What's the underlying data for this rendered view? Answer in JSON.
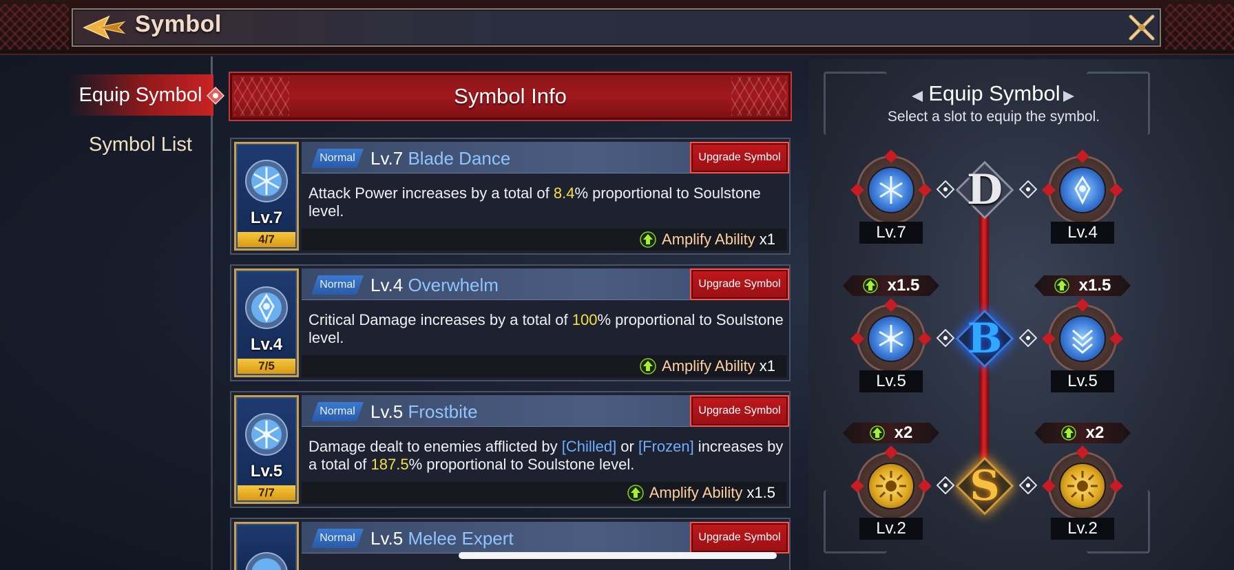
{
  "header": {
    "title": "Symbol",
    "back_icon": "back-arrow-icon",
    "close_icon": "crossed-swords-close-icon"
  },
  "nav": {
    "items": [
      {
        "label": "Equip Symbol",
        "active": true
      },
      {
        "label": "Symbol List",
        "active": false
      }
    ]
  },
  "symbol_info": {
    "title": "Symbol Info",
    "cards": [
      {
        "grade": "Normal",
        "level": "Lv.7",
        "name": "Blade Dance",
        "thumb_level": "Lv.7",
        "count": "4/7",
        "upgrade_label": "Upgrade Symbol",
        "desc_pre": "Attack Power increases by a total of ",
        "desc_value": "8.4",
        "desc_post": "% proportional to Soulstone level.",
        "amplify_label": "Amplify Ability",
        "amplify_mult": "x1",
        "icon": "blade-dance-icon"
      },
      {
        "grade": "Normal",
        "level": "Lv.4",
        "name": "Overwhelm",
        "thumb_level": "Lv.4",
        "count": "7/5",
        "upgrade_label": "Upgrade Symbol",
        "desc_pre": "Critical Damage increases by a total of ",
        "desc_value": "100",
        "desc_post": "% proportional to Soulstone level.",
        "amplify_label": "Amplify Ability",
        "amplify_mult": "x1",
        "icon": "overwhelm-icon"
      },
      {
        "grade": "Normal",
        "level": "Lv.5",
        "name": "Frostbite",
        "thumb_level": "Lv.5",
        "count": "7/7",
        "upgrade_label": "Upgrade Symbol",
        "desc_pre": "Damage dealt to enemies afflicted by ",
        "desc_kw1": "[Chilled]",
        "desc_mid": " or ",
        "desc_kw2": "[Frozen]",
        "desc_mid2": " increases by a total of ",
        "desc_value": "187.5",
        "desc_post": "% proportional to Soulstone level.",
        "amplify_label": "Amplify Ability",
        "amplify_mult": "x1.5",
        "icon": "snowflake-icon"
      },
      {
        "grade": "Normal",
        "level": "Lv.5",
        "name": "Melee Expert",
        "upgrade_label": "Upgrade Symbol",
        "icon": "melee-expert-icon"
      }
    ]
  },
  "equip_panel": {
    "title": "Equip Symbol",
    "subtitle": "Select a slot to equip the symbol.",
    "grades": [
      "D",
      "B",
      "S"
    ],
    "slots": [
      {
        "pos": "d-left",
        "level": "Lv.7",
        "icon": "blade-dance-icon",
        "color": "blue"
      },
      {
        "pos": "d-right",
        "level": "Lv.4",
        "icon": "overwhelm-icon",
        "color": "blue"
      },
      {
        "pos": "b-left",
        "level": "Lv.5",
        "icon": "snowflake-icon",
        "color": "blue",
        "mult": "x1.5"
      },
      {
        "pos": "b-right",
        "level": "Lv.5",
        "icon": "melee-expert-icon",
        "color": "blue",
        "mult": "x1.5"
      },
      {
        "pos": "s-left",
        "level": "Lv.2",
        "icon": "sun-burst-icon",
        "color": "gold",
        "mult": "x2"
      },
      {
        "pos": "s-right",
        "level": "Lv.2",
        "icon": "sun-burst-icon",
        "color": "gold",
        "mult": "x2"
      }
    ]
  },
  "colors": {
    "accent_red": "#c0181c",
    "highlight_yellow": "#f4e040",
    "keyword_blue": "#6ab0ff",
    "name_blue": "#8fc4ff",
    "gold": "#f6c640"
  }
}
